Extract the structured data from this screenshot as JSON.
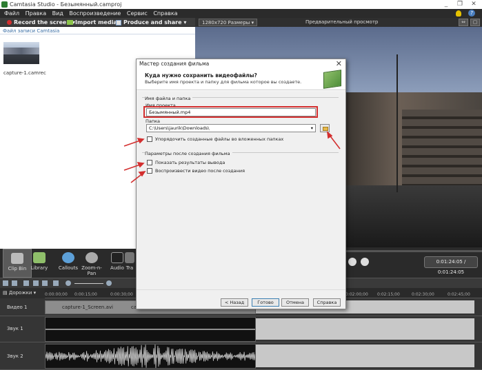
{
  "window": {
    "title": "Camtasia Studio - Безымянный.camproj",
    "buttons": [
      "_",
      "❐",
      "✕"
    ]
  },
  "menu": [
    "Файл",
    "Правка",
    "Вид",
    "Воспроизведение",
    "Сервис",
    "Справка"
  ],
  "toolbar": {
    "record": "Record the screen",
    "record_arrow": "▾",
    "import": "Import media",
    "produce": "Produce and share",
    "produce_arrow": "▾"
  },
  "clip_bin": {
    "header": "Файл записи Camtasia",
    "items": [
      {
        "label": "capture-1.camrec"
      }
    ]
  },
  "preview": {
    "size": "1280x720 Размеры",
    "size_arrow": "▾",
    "title": "Предварительный просмотр",
    "time": "0:01:24:05 / 0:01:24:05"
  },
  "tasks": [
    {
      "label": "Clip Bin"
    },
    {
      "label": "Library"
    },
    {
      "label": "Callouts"
    },
    {
      "label": "Zoom-n-\nPan"
    },
    {
      "label": "Audio"
    },
    {
      "label": "Tra"
    }
  ],
  "timeline": {
    "tracks_label": "Дорожки",
    "ticks": [
      "0:00:00;00",
      "0:00:15;00",
      "0:00:30;00",
      "0:02:00;00",
      "0:02:15;00",
      "0:02:30;00",
      "0:02:45;00"
    ],
    "tracks": [
      {
        "name": "Видео 1",
        "clip": "capture-1_Screen.avi",
        "clip2": "ca"
      },
      {
        "name": "Звук 1"
      },
      {
        "name": "Звук 2"
      }
    ]
  },
  "dialog": {
    "title": "Мастер создания фильма",
    "close": "✕",
    "heading": "Куда нужно сохранить видеофайлы?",
    "subheading": "Выберите имя проекта и папку для фильма которое вы создаете.",
    "group1": "Имя файла и папка",
    "project_label": "Имя проекта",
    "project_value": "Безымянный.mp4",
    "folder_label": "Папка",
    "folder_value": "C:\\Users\\jaurik\\Downloads\\",
    "folder_arrow": "▾",
    "organize": "Упорядочить созданные файлы во вложенных папках",
    "group2": "Параметры после создания фильма",
    "opt1": "Показать результаты вывода",
    "opt2": "Воспроизвести видео после создания",
    "buttons": {
      "back": "< Назад",
      "finish": "Готово",
      "cancel": "Отмена",
      "help": "Справка"
    }
  },
  "colors": {
    "annotation": "#d32f2f"
  }
}
